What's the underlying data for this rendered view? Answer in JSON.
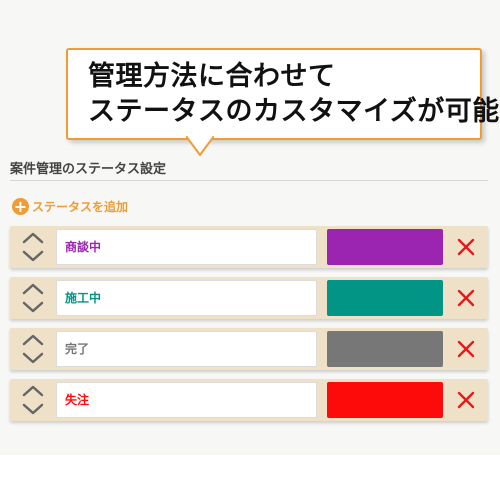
{
  "callout": {
    "line1": "管理方法に合わせて",
    "line2": "ステータスのカスタマイズが可能"
  },
  "settings": {
    "title": "案件管理のステータス設定",
    "add_label": "ステータスを追加",
    "add_icon": "plus-circle-icon",
    "statuses": [
      {
        "label": "商談中",
        "color": "#9b25b0"
      },
      {
        "label": "施工中",
        "color": "#029485"
      },
      {
        "label": "完了",
        "color": "#777777"
      },
      {
        "label": "失注",
        "color": "#fd0b0b"
      }
    ]
  },
  "colors": {
    "accent": "#ee9c33",
    "row_bg": "#efe1c8",
    "delete": "#e31b1b"
  }
}
